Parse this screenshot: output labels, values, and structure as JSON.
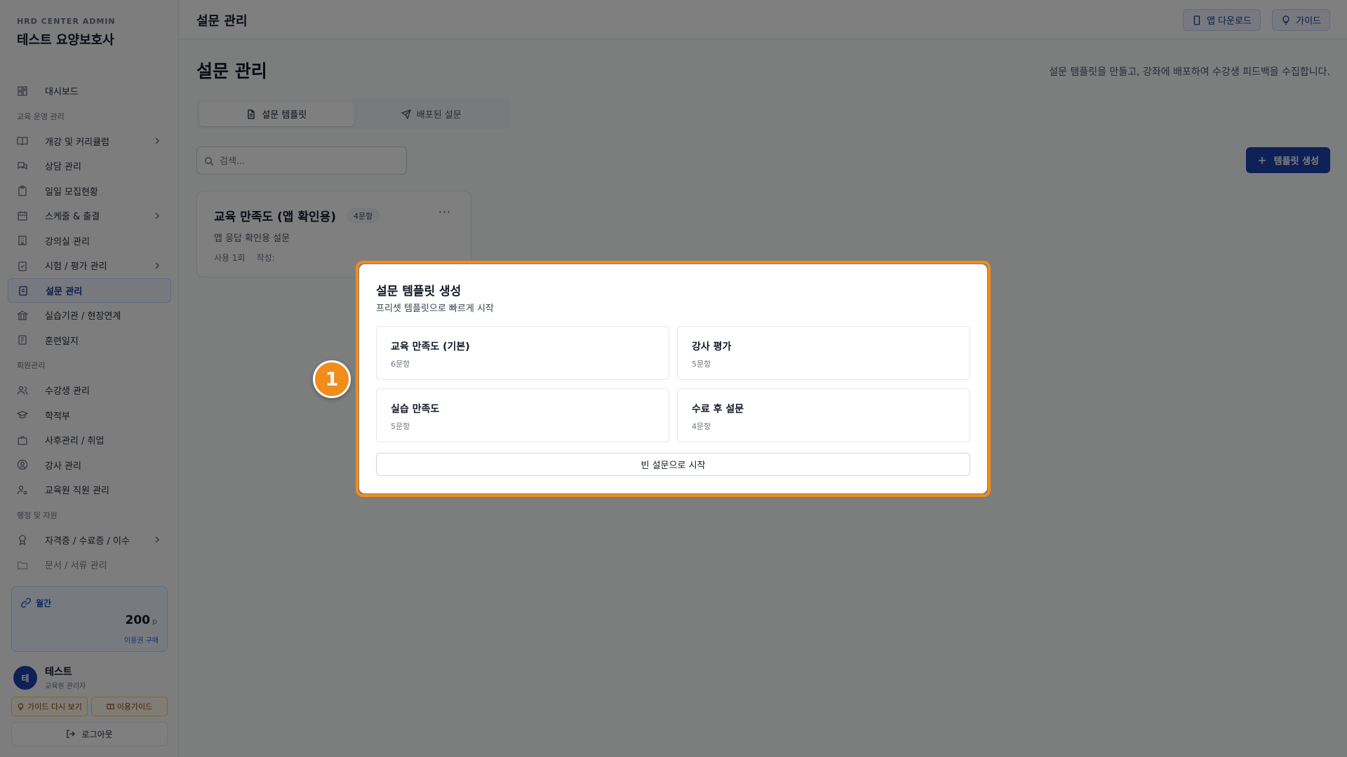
{
  "brand": {
    "sub": "HRD CENTER ADMIN",
    "title": "테스트 요양보호사"
  },
  "nav": {
    "dashboard": "대시보드",
    "section_edu": "교육 운영 관리",
    "courses": "개강 및 커리큘럼",
    "consult": "상담 관리",
    "daily_recruit": "일일 모집현황",
    "schedule": "스케줄 & 출결",
    "classroom": "강의실 관리",
    "exam": "시험 / 평가 관리",
    "survey": "설문 관리",
    "practice": "실습기관 / 현장연계",
    "training_log": "훈련일지",
    "section_member": "회원관리",
    "students": "수강생 관리",
    "records": "학적부",
    "aftercare": "사후관리 / 취업",
    "instructors": "강사 관리",
    "staff": "교육원 직원 관리",
    "section_admin": "행정 및 자원",
    "certificates": "자격증 / 수료증 / 이수",
    "documents": "문서 / 서류 관리"
  },
  "plan": {
    "label": "월간",
    "amount": "200",
    "unit": "p",
    "buy": "이용권 구매"
  },
  "user": {
    "initial": "테",
    "name": "테스트",
    "role": "교육원 관리자"
  },
  "sidebar_footer": {
    "guide_again": "가이드 다시 보기",
    "usage_guide": "이용가이드",
    "logout": "로그아웃"
  },
  "topbar": {
    "title": "설문 관리",
    "app_download": "앱 다운로드",
    "guide": "가이드"
  },
  "main": {
    "title": "설문 관리",
    "description": "설문 템플릿을 만들고, 강좌에 배포하여 수강생 피드백을 수집합니다.",
    "tabs": [
      "설문 템플릿",
      "배포된 설문"
    ],
    "search_placeholder": "검색...",
    "create_button": "템플릿 생성",
    "template_card": {
      "title": "교육 만족도 (앱 확인용)",
      "badge": "4문항",
      "description": "앱 응답 확인용 설문",
      "usage": "사용 1회",
      "author": "작성:"
    }
  },
  "modal": {
    "title": "설문 템플릿 생성",
    "subtitle": "프리셋 템플릿으로 빠르게 시작",
    "presets": [
      {
        "name": "교육 만족도 (기본)",
        "count": "6문항"
      },
      {
        "name": "강사 평가",
        "count": "5문항"
      },
      {
        "name": "실습 만족도",
        "count": "5문항"
      },
      {
        "name": "수료 후 설문",
        "count": "4문항"
      }
    ],
    "blank_button": "빈 설문으로 시작"
  },
  "annotation": {
    "step": "1"
  },
  "colors": {
    "primary": "#1e40af",
    "highlight": "#f28c1a",
    "overlay": "rgba(0,0,0,0.5)"
  }
}
